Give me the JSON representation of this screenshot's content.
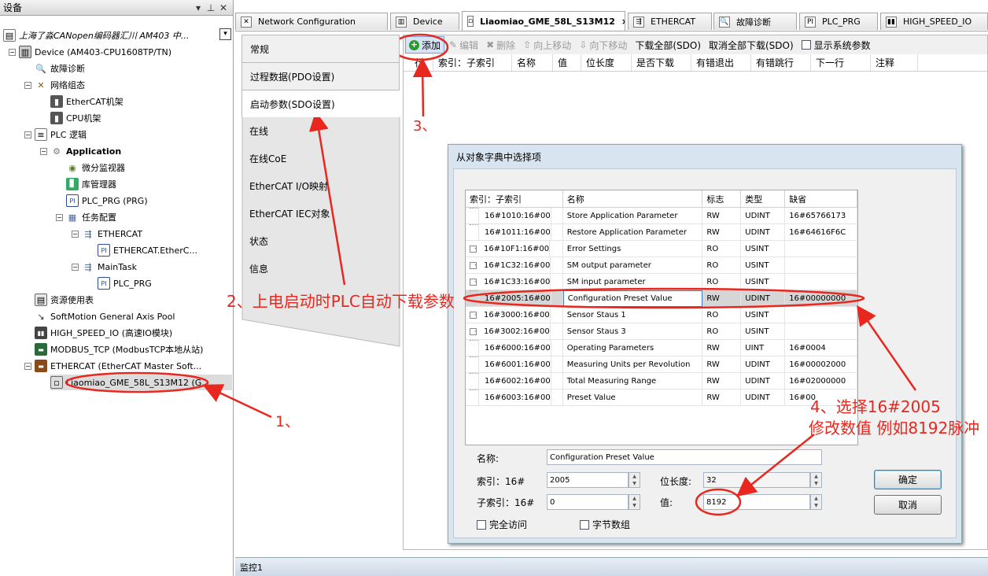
{
  "left_panel": {
    "title": "设备",
    "tree": [
      {
        "label": "上海了淼CANopen编码器汇川 AM403 中...",
        "icon": "project-icon",
        "expander": "−",
        "italic": true
      },
      {
        "label": "Device (AM403-CPU1608TP/TN)",
        "icon": "device-icon",
        "expander": "−"
      },
      {
        "label": "故障诊断",
        "icon": "diagnosis-icon"
      },
      {
        "label": "网络组态",
        "icon": "network-icon",
        "expander": "−"
      },
      {
        "label": "EtherCAT机架",
        "icon": "rack-icon"
      },
      {
        "label": "CPU机架",
        "icon": "rack-icon"
      },
      {
        "label": "PLC 逻辑",
        "icon": "plc-logic-icon",
        "expander": "−"
      },
      {
        "label": "Application",
        "icon": "application-icon",
        "expander": "−",
        "bold": true
      },
      {
        "label": "微分监视器",
        "icon": "monitor-icon"
      },
      {
        "label": "库管理器",
        "icon": "library-icon"
      },
      {
        "label": "PLC_PRG (PRG)",
        "icon": "program-icon"
      },
      {
        "label": "任务配置",
        "icon": "task-config-icon",
        "expander": "−"
      },
      {
        "label": "ETHERCAT",
        "icon": "task-icon",
        "expander": "−"
      },
      {
        "label": "ETHERCAT.EtherC...",
        "icon": "program-icon"
      },
      {
        "label": "MainTask",
        "icon": "task-icon",
        "expander": "−"
      },
      {
        "label": "PLC_PRG",
        "icon": "program-icon"
      },
      {
        "label": "资源使用表",
        "icon": "table-icon"
      },
      {
        "label": "SoftMotion General Axis Pool",
        "icon": "axis-pool-icon"
      },
      {
        "label": "HIGH_SPEED_IO (高速IO模块)",
        "icon": "io-module-icon"
      },
      {
        "label": "MODBUS_TCP (ModbusTCP本地从站)",
        "icon": "modbus-icon"
      },
      {
        "label": "ETHERCAT (EtherCAT Master Soft...",
        "icon": "ethercat-master-icon",
        "expander": "−"
      },
      {
        "label": "Liaomiao_GME_58L_S13M12 (G...",
        "icon": "slave-device-icon",
        "selected": true
      }
    ]
  },
  "tabs": [
    {
      "label": "Network Configuration",
      "icon": "network-icon"
    },
    {
      "label": "Device",
      "icon": "device-icon"
    },
    {
      "label": "Liaomiao_GME_58L_S13M12",
      "icon": "slave-device-icon",
      "active": true,
      "close": "×"
    },
    {
      "label": "ETHERCAT",
      "icon": "task-icon"
    },
    {
      "label": "故障诊断",
      "icon": "diagnosis-icon"
    },
    {
      "label": "PLC_PRG",
      "icon": "program-icon"
    },
    {
      "label": "HIGH_SPEED_IO",
      "icon": "io-module-icon"
    }
  ],
  "side_tabs": [
    "常规",
    "过程数据(PDO设置)",
    "启动参数(SDO设置)",
    "在线",
    "在线CoE",
    "EtherCAT I/O映射",
    "EtherCAT IEC对象",
    "状态",
    "信息"
  ],
  "toolbar": {
    "add": "添加",
    "edit": "编辑",
    "delete": "删除",
    "move_up": "向上移动",
    "move_down": "向下移动",
    "download_all": "下载全部(SDO)",
    "cancel_download_all": "取消全部下载(SDO)",
    "show_system": "显示系统参数"
  },
  "grid_columns": [
    "行",
    "索引：子索引",
    "名称",
    "值",
    "位长度",
    "是否下载",
    "有错退出",
    "有错跳行",
    "下一行",
    "注释"
  ],
  "dialog": {
    "title": "从对象字典中选择项",
    "columns": [
      "索引：子索引",
      "名称",
      "标志",
      "类型",
      "缺省"
    ],
    "rows": [
      {
        "idx": "16#1010:16#00",
        "name": "Store Application Parameter",
        "flag": "RW",
        "type": "UDINT",
        "default": "16#65766173",
        "expander": ""
      },
      {
        "idx": "16#1011:16#00",
        "name": "Restore Application Parameter",
        "flag": "RW",
        "type": "UDINT",
        "default": "16#64616F6C",
        "expander": ""
      },
      {
        "idx": "16#10F1:16#00",
        "name": "Error Settings",
        "flag": "RO",
        "type": "USINT",
        "default": "",
        "expander": "+"
      },
      {
        "idx": "16#1C32:16#00",
        "name": "SM output parameter",
        "flag": "RO",
        "type": "USINT",
        "default": "",
        "expander": "+"
      },
      {
        "idx": "16#1C33:16#00",
        "name": "SM input parameter",
        "flag": "RO",
        "type": "USINT",
        "default": "",
        "expander": "+"
      },
      {
        "idx": "16#2005:16#00",
        "name": "Configuration Preset Value",
        "flag": "RW",
        "type": "UDINT",
        "default": "16#00000000",
        "expander": "",
        "selected": true
      },
      {
        "idx": "16#3000:16#00",
        "name": "Sensor Staus 1",
        "flag": "RO",
        "type": "USINT",
        "default": "",
        "expander": "+"
      },
      {
        "idx": "16#3002:16#00",
        "name": "Sensor Staus 3",
        "flag": "RO",
        "type": "USINT",
        "default": "",
        "expander": "+"
      },
      {
        "idx": "16#6000:16#00",
        "name": "Operating Parameters",
        "flag": "RW",
        "type": "UINT",
        "default": "16#0004",
        "expander": ""
      },
      {
        "idx": "16#6001:16#00",
        "name": "Measuring Units per Revolution",
        "flag": "RW",
        "type": "UDINT",
        "default": "16#00002000",
        "expander": ""
      },
      {
        "idx": "16#6002:16#00",
        "name": "Total Measuring Range",
        "flag": "RW",
        "type": "UDINT",
        "default": "16#02000000",
        "expander": ""
      },
      {
        "idx": "16#6003:16#00",
        "name": "Preset Value",
        "flag": "RW",
        "type": "UDINT",
        "default": "16#00",
        "expander": ""
      }
    ],
    "name_label": "名称:",
    "name_value": "Configuration Preset Value",
    "index_label": "索引：16#",
    "index_value": "2005",
    "subindex_label": "子索引：16#",
    "subindex_value": "0",
    "bitlen_label": "位长度:",
    "bitlen_value": "32",
    "value_label": "值:",
    "value_value": "8192",
    "full_access": "完全访问",
    "byte_array": "字节数组",
    "ok": "确定",
    "cancel": "取消"
  },
  "status_bar": "监控1",
  "annotations": {
    "a1": "1、",
    "a2": "2、上电启动时PLC自动下载参数",
    "a3": "3、",
    "a4_line1": "4、选择16#2005",
    "a4_line2": "修改数值 例如8192脉冲",
    "color": "#e8271f"
  }
}
